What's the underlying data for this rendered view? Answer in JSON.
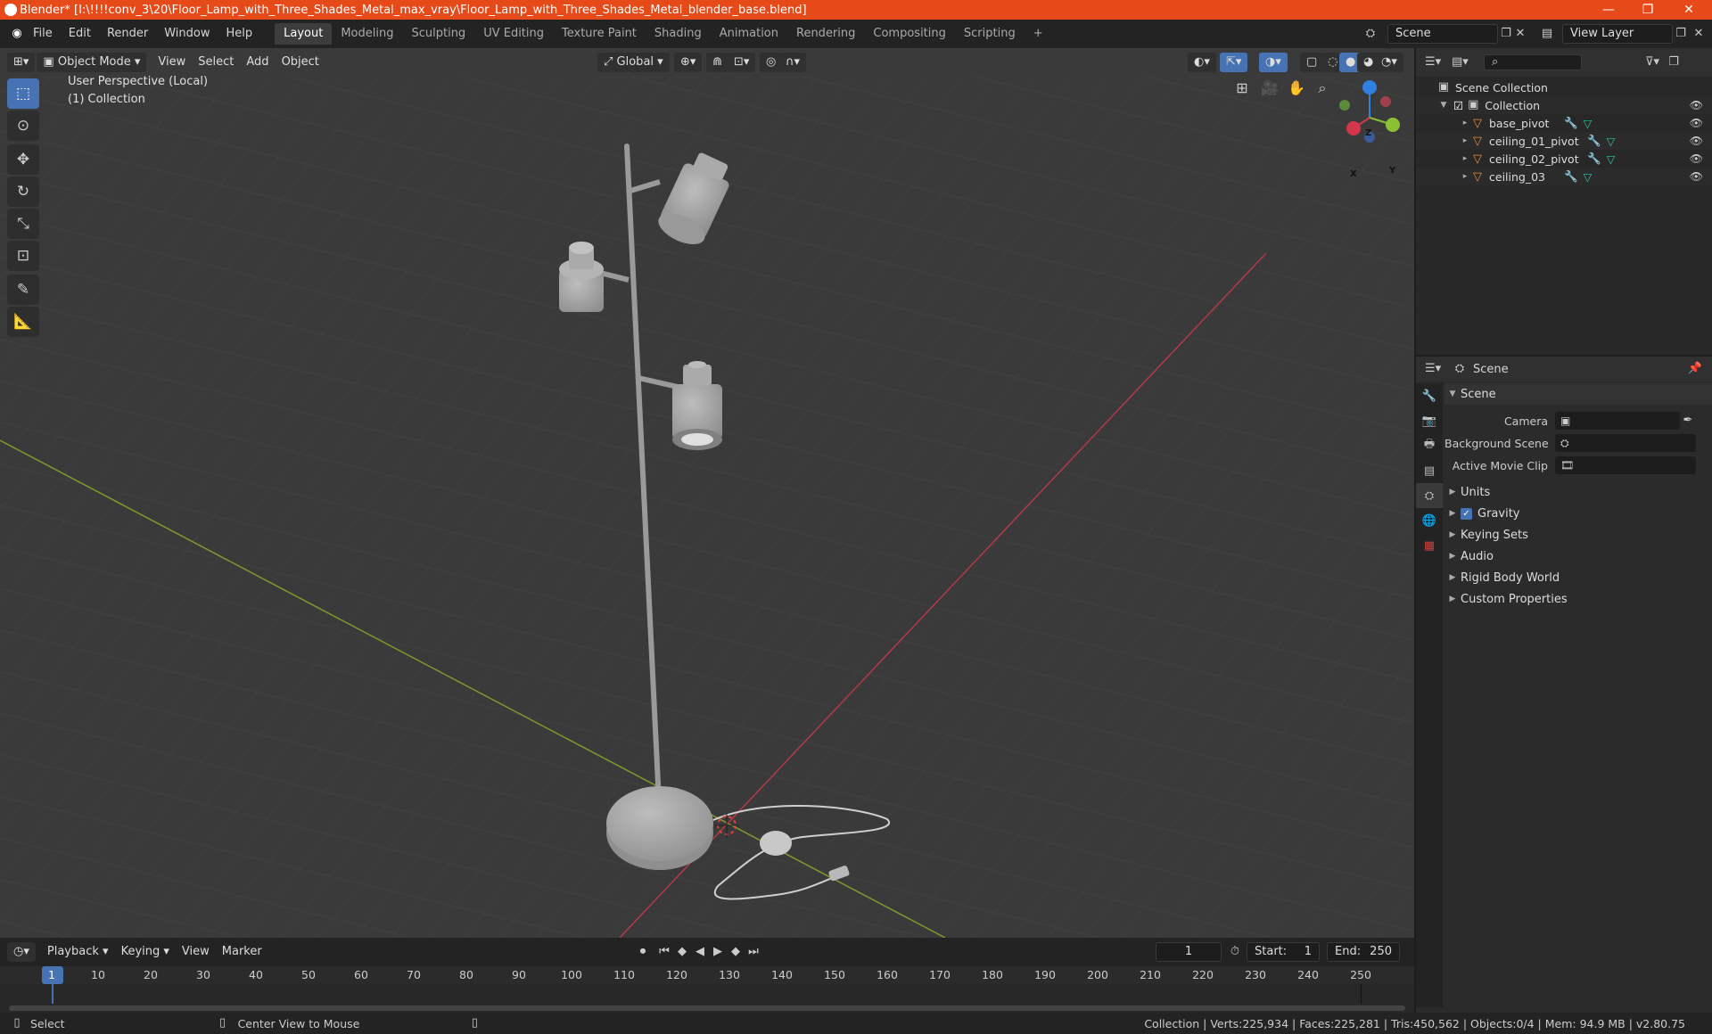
{
  "window": {
    "title": "Blender* [I:\\!!!!conv_3\\20\\Floor_Lamp_with_Three_Shades_Metal_max_vray\\Floor_Lamp_with_Three_Shades_Metal_blender_base.blend]",
    "minimize": "—",
    "restore": "❐",
    "close": "✕"
  },
  "topbar": {
    "menus": [
      "File",
      "Edit",
      "Render",
      "Window",
      "Help"
    ],
    "workspaces": [
      "Layout",
      "Modeling",
      "Sculpting",
      "UV Editing",
      "Texture Paint",
      "Shading",
      "Animation",
      "Rendering",
      "Compositing",
      "Scripting"
    ],
    "active_workspace": "Layout",
    "add_workspace": "+",
    "scene_name": "Scene",
    "view_layer": "View Layer"
  },
  "viewport": {
    "mode": "Object Mode",
    "menus": [
      "View",
      "Select",
      "Add",
      "Object"
    ],
    "transform_orientation": "Global",
    "perspective_label": "User Perspective (Local)",
    "collection_label": "(1) Collection",
    "gizmo_axes": {
      "x": "X",
      "y": "Y",
      "z": "Z"
    }
  },
  "outliner": {
    "root": "Scene Collection",
    "collection": "Collection",
    "objects": [
      {
        "name": "base_pivot"
      },
      {
        "name": "ceiling_01_pivot"
      },
      {
        "name": "ceiling_02_pivot"
      },
      {
        "name": "ceiling_03"
      }
    ]
  },
  "properties": {
    "context": "Scene",
    "panel": "Scene",
    "fields": [
      {
        "label": "Camera"
      },
      {
        "label": "Background Scene"
      },
      {
        "label": "Active Movie Clip"
      }
    ],
    "sections": [
      "Units",
      "Gravity",
      "Keying Sets",
      "Audio",
      "Rigid Body World",
      "Custom Properties"
    ]
  },
  "timeline": {
    "menus": [
      "Playback",
      "Keying",
      "View",
      "Marker"
    ],
    "current_frame": "1",
    "start_label": "Start:",
    "start": "1",
    "end_label": "End:",
    "end": "250",
    "ticks": [
      "1",
      "10",
      "20",
      "30",
      "40",
      "50",
      "60",
      "70",
      "80",
      "90",
      "100",
      "110",
      "120",
      "130",
      "140",
      "150",
      "160",
      "170",
      "180",
      "190",
      "200",
      "210",
      "220",
      "230",
      "240",
      "250"
    ]
  },
  "statusbar": {
    "left_action": "Select",
    "mid_action": "Center View to Mouse",
    "stats": "Collection | Verts:225,934 | Faces:225,281 | Tris:450,562 | Objects:0/4 | Mem: 94.9 MB | v2.80.75"
  },
  "colors": {
    "title_bar": "#e64a19",
    "accent": "#4772b3",
    "x_axis": "#d4364d",
    "y_axis": "#8bc034",
    "z_axis": "#2f80e0",
    "object_icon": "#e88b3a"
  }
}
